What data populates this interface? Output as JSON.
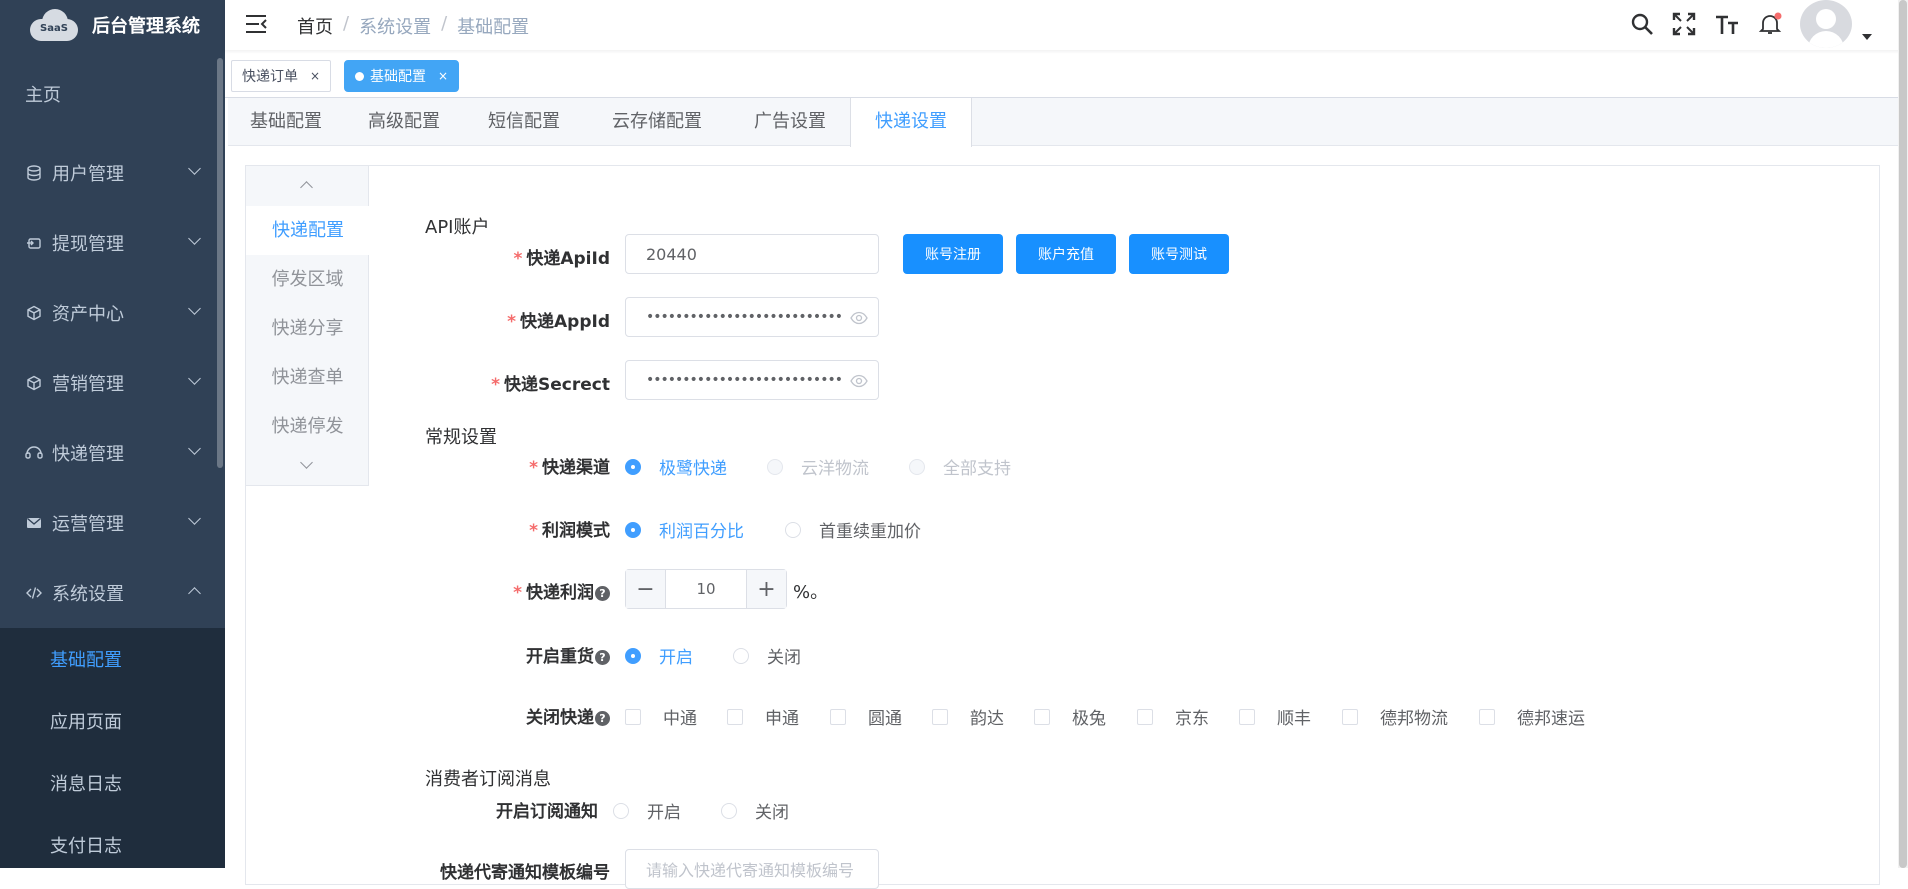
{
  "app": {
    "logo_text": "SaaS",
    "title": "后台管理系统"
  },
  "sidebar": {
    "home": "主页",
    "items": [
      {
        "label": "用户管理",
        "icon": "database-icon"
      },
      {
        "label": "提现管理",
        "icon": "withdraw-icon"
      },
      {
        "label": "资产中心",
        "icon": "cube-icon"
      },
      {
        "label": "营销管理",
        "icon": "cube-icon"
      },
      {
        "label": "快递管理",
        "icon": "delivery-icon"
      },
      {
        "label": "运营管理",
        "icon": "mail-icon"
      },
      {
        "label": "系统设置",
        "icon": "code-icon",
        "expanded": true
      }
    ],
    "sub_items": [
      {
        "label": "基础配置",
        "active": true
      },
      {
        "label": "应用页面"
      },
      {
        "label": "消息日志"
      },
      {
        "label": "支付日志"
      }
    ]
  },
  "breadcrumb": [
    "首页",
    "系统设置",
    "基础配置"
  ],
  "tags": [
    {
      "label": "快递订单",
      "close": "×"
    },
    {
      "label": "基础配置",
      "close": "×",
      "active": true
    }
  ],
  "tabs": [
    "基础配置",
    "高级配置",
    "短信配置",
    "云存储配置",
    "广告设置",
    "快递设置"
  ],
  "active_tab": "快递设置",
  "vtabs": [
    "快递配置",
    "停发区域",
    "快递分享",
    "快递查单",
    "快递停发"
  ],
  "active_vtab": "快递配置",
  "form": {
    "api_section": "API账户",
    "apiid": {
      "label": "快递ApiId",
      "value": "20440"
    },
    "appid": {
      "label": "快递AppId",
      "masked": "••••••••••••••••••••••••••••••••••••••"
    },
    "secret": {
      "label": "快递Secrect",
      "masked": "••••••••••••••••••••••••••••••••••••••"
    },
    "buttons": [
      "账号注册",
      "账户充值",
      "账号测试"
    ],
    "general_section": "常规设置",
    "channel": {
      "label": "快递渠道",
      "options": [
        "极鹭快递",
        "云洋物流",
        "全部支持"
      ],
      "selected": "极鹭快递"
    },
    "profit_mode": {
      "label": "利润模式",
      "options": [
        "利润百分比",
        "首重续重加价"
      ],
      "selected": "利润百分比"
    },
    "profit": {
      "label": "快递利润",
      "value": "10",
      "unit": "%。",
      "minus": "−",
      "plus": "+"
    },
    "heavy": {
      "label": "开启重货",
      "options": [
        "开启",
        "关闭"
      ],
      "selected": "开启"
    },
    "close_express": {
      "label": "关闭快递",
      "options": [
        "中通",
        "申通",
        "圆通",
        "韵达",
        "极兔",
        "京东",
        "顺丰",
        "德邦物流",
        "德邦速运"
      ]
    },
    "consumer_section": "消费者订阅消息",
    "subscribe": {
      "label": "开启订阅通知",
      "options": [
        "开启",
        "关闭"
      ]
    },
    "template": {
      "label": "快递代寄通知模板编号",
      "placeholder": "请输入快递代寄通知模板编号"
    }
  },
  "colors": {
    "sidebar_bg": "#304156",
    "accent": "#409eff",
    "button": "#1890ff",
    "required": "#f56c6c"
  }
}
